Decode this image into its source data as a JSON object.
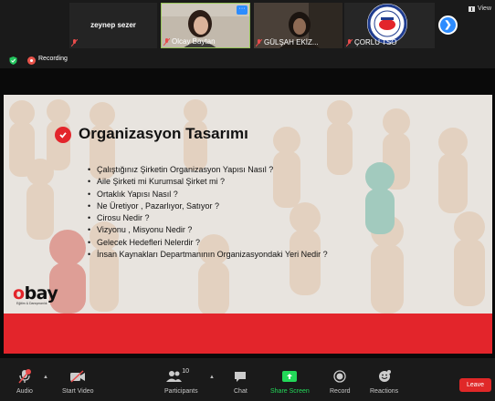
{
  "gallery": {
    "tiles": [
      {
        "name": "zeynep sezer",
        "label": ""
      },
      {
        "name": "Olcay Baytan"
      },
      {
        "name": "GÜLŞAH EKİZ..."
      },
      {
        "name": "ÇORLU TSO"
      }
    ],
    "more_badge": "···",
    "view_label": "View"
  },
  "status": {
    "recording_label": "Recording"
  },
  "slide": {
    "title": "Organizasyon Tasarımı",
    "bullets": [
      "Çalıştığınız Şirketin Organizasyon Yapısı Nasıl ?",
      "Aile Şirketi mi Kurumsal Şirket mi ?",
      "Ortaklık Yapısı Nasıl ?",
      "Ne Üretiyor , Pazarlıyor, Satıyor ?",
      "Cirosu Nedir ?",
      "Vizyonu , Misyonu Nedir ?",
      "Gelecek Hedefleri Nelerdir ?",
      "İnsan Kaynakları Departmanının Organizasyondaki Yeri Nedir ?"
    ],
    "logo_text": "bay",
    "logo_initial": "o",
    "logo_sub": "Eğitim & Danışmanlık"
  },
  "toolbar": {
    "audio": "Audio",
    "start_video": "Start Video",
    "participants": "Participants",
    "participants_count": "10",
    "chat": "Chat",
    "share_screen": "Share Screen",
    "record": "Record",
    "reactions": "Reactions",
    "leave": "Leave"
  },
  "colors": {
    "accent_blue": "#2d8cff",
    "brand_red": "#e3252b",
    "share_green": "#23d959",
    "leave_red": "#e02828"
  }
}
